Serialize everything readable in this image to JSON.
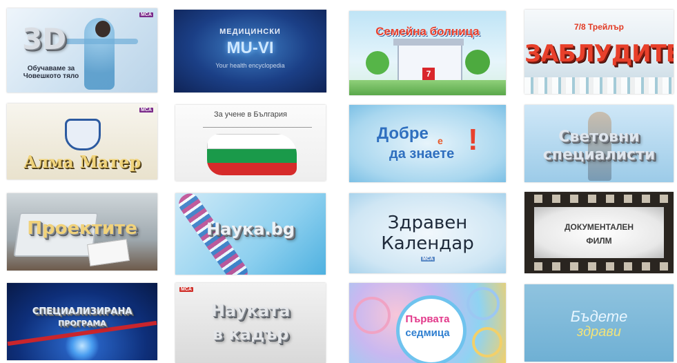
{
  "tiles": {
    "t1": {
      "title": "3D",
      "subtitle": "Обучаваме за Човешкото тяло"
    },
    "t2": {
      "kicker": "МЕДИЦИНСКИ",
      "title": "MU-VI",
      "subtitle": "Your health encyclopedia"
    },
    "t3": {
      "title": "Семейна болница",
      "plaque": "7"
    },
    "t4": {
      "kicker": "7/8 Трейлър",
      "title": "ЗАБЛУДИТЕ"
    },
    "t5": {
      "title": "Алма Матер"
    },
    "t6": {
      "title": "За учене в България"
    },
    "t7": {
      "title_line1": "Добре",
      "title_mid": "е",
      "title_line2": "да знаете",
      "mark": "!"
    },
    "t8": {
      "title": "Световни специалисти"
    },
    "t9": {
      "title": "Проектите"
    },
    "t10": {
      "title": "Наука.bg"
    },
    "t11": {
      "title_line1": "Здравен",
      "title_line2": "Календар"
    },
    "t12": {
      "title_line1": "ДОКУМЕНТАЛЕН",
      "title_line2": "ФИЛМ"
    },
    "t13": {
      "title_line1": "СПЕЦИАЛИЗИРАНА",
      "title_line2": "ПРОГРАМА"
    },
    "t14": {
      "title_line1": "Науката",
      "title_line2": "в кадър"
    },
    "t15": {
      "title_line1": "Първата",
      "title_line2": "седмица"
    },
    "t16": {
      "title_line1": "Бъдете",
      "title_line2": "здрави"
    }
  },
  "badge": "MCA"
}
